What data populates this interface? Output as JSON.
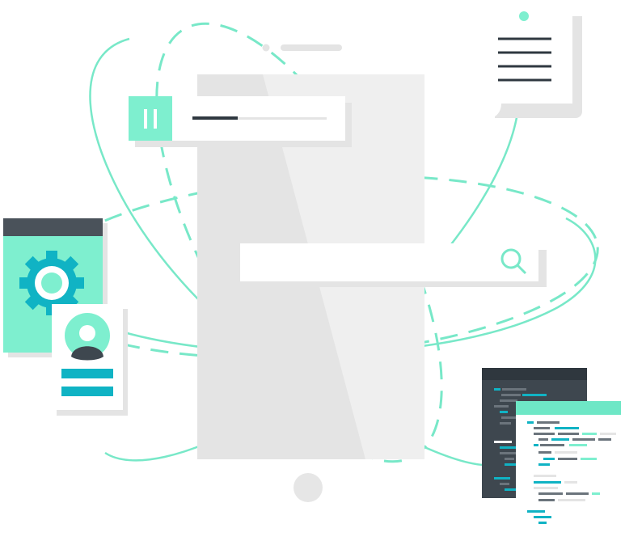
{
  "colors": {
    "accent": "#7EEFCF",
    "accent_line": "#78E8C8",
    "teal": "#10B3C4",
    "dark": "#3E474F",
    "dark_header": "#4A525A",
    "phone_body": "#EDEDED",
    "phone_shade": "#E2E2E2",
    "panel_shadow": "#E4E4E4",
    "white": "#FFFFFF"
  },
  "media_player": {
    "progress": 0.34,
    "pause_icon": "pause-icon"
  },
  "search_bar": {
    "value": "",
    "icon": "search-icon"
  },
  "settings_card": {
    "icon": "gear-icon"
  },
  "profile_card": {
    "icon": "user-avatar-icon"
  },
  "document": {
    "icon": "menu-lines-icon"
  },
  "code_windows": {
    "icon": "code-lines-icon"
  }
}
